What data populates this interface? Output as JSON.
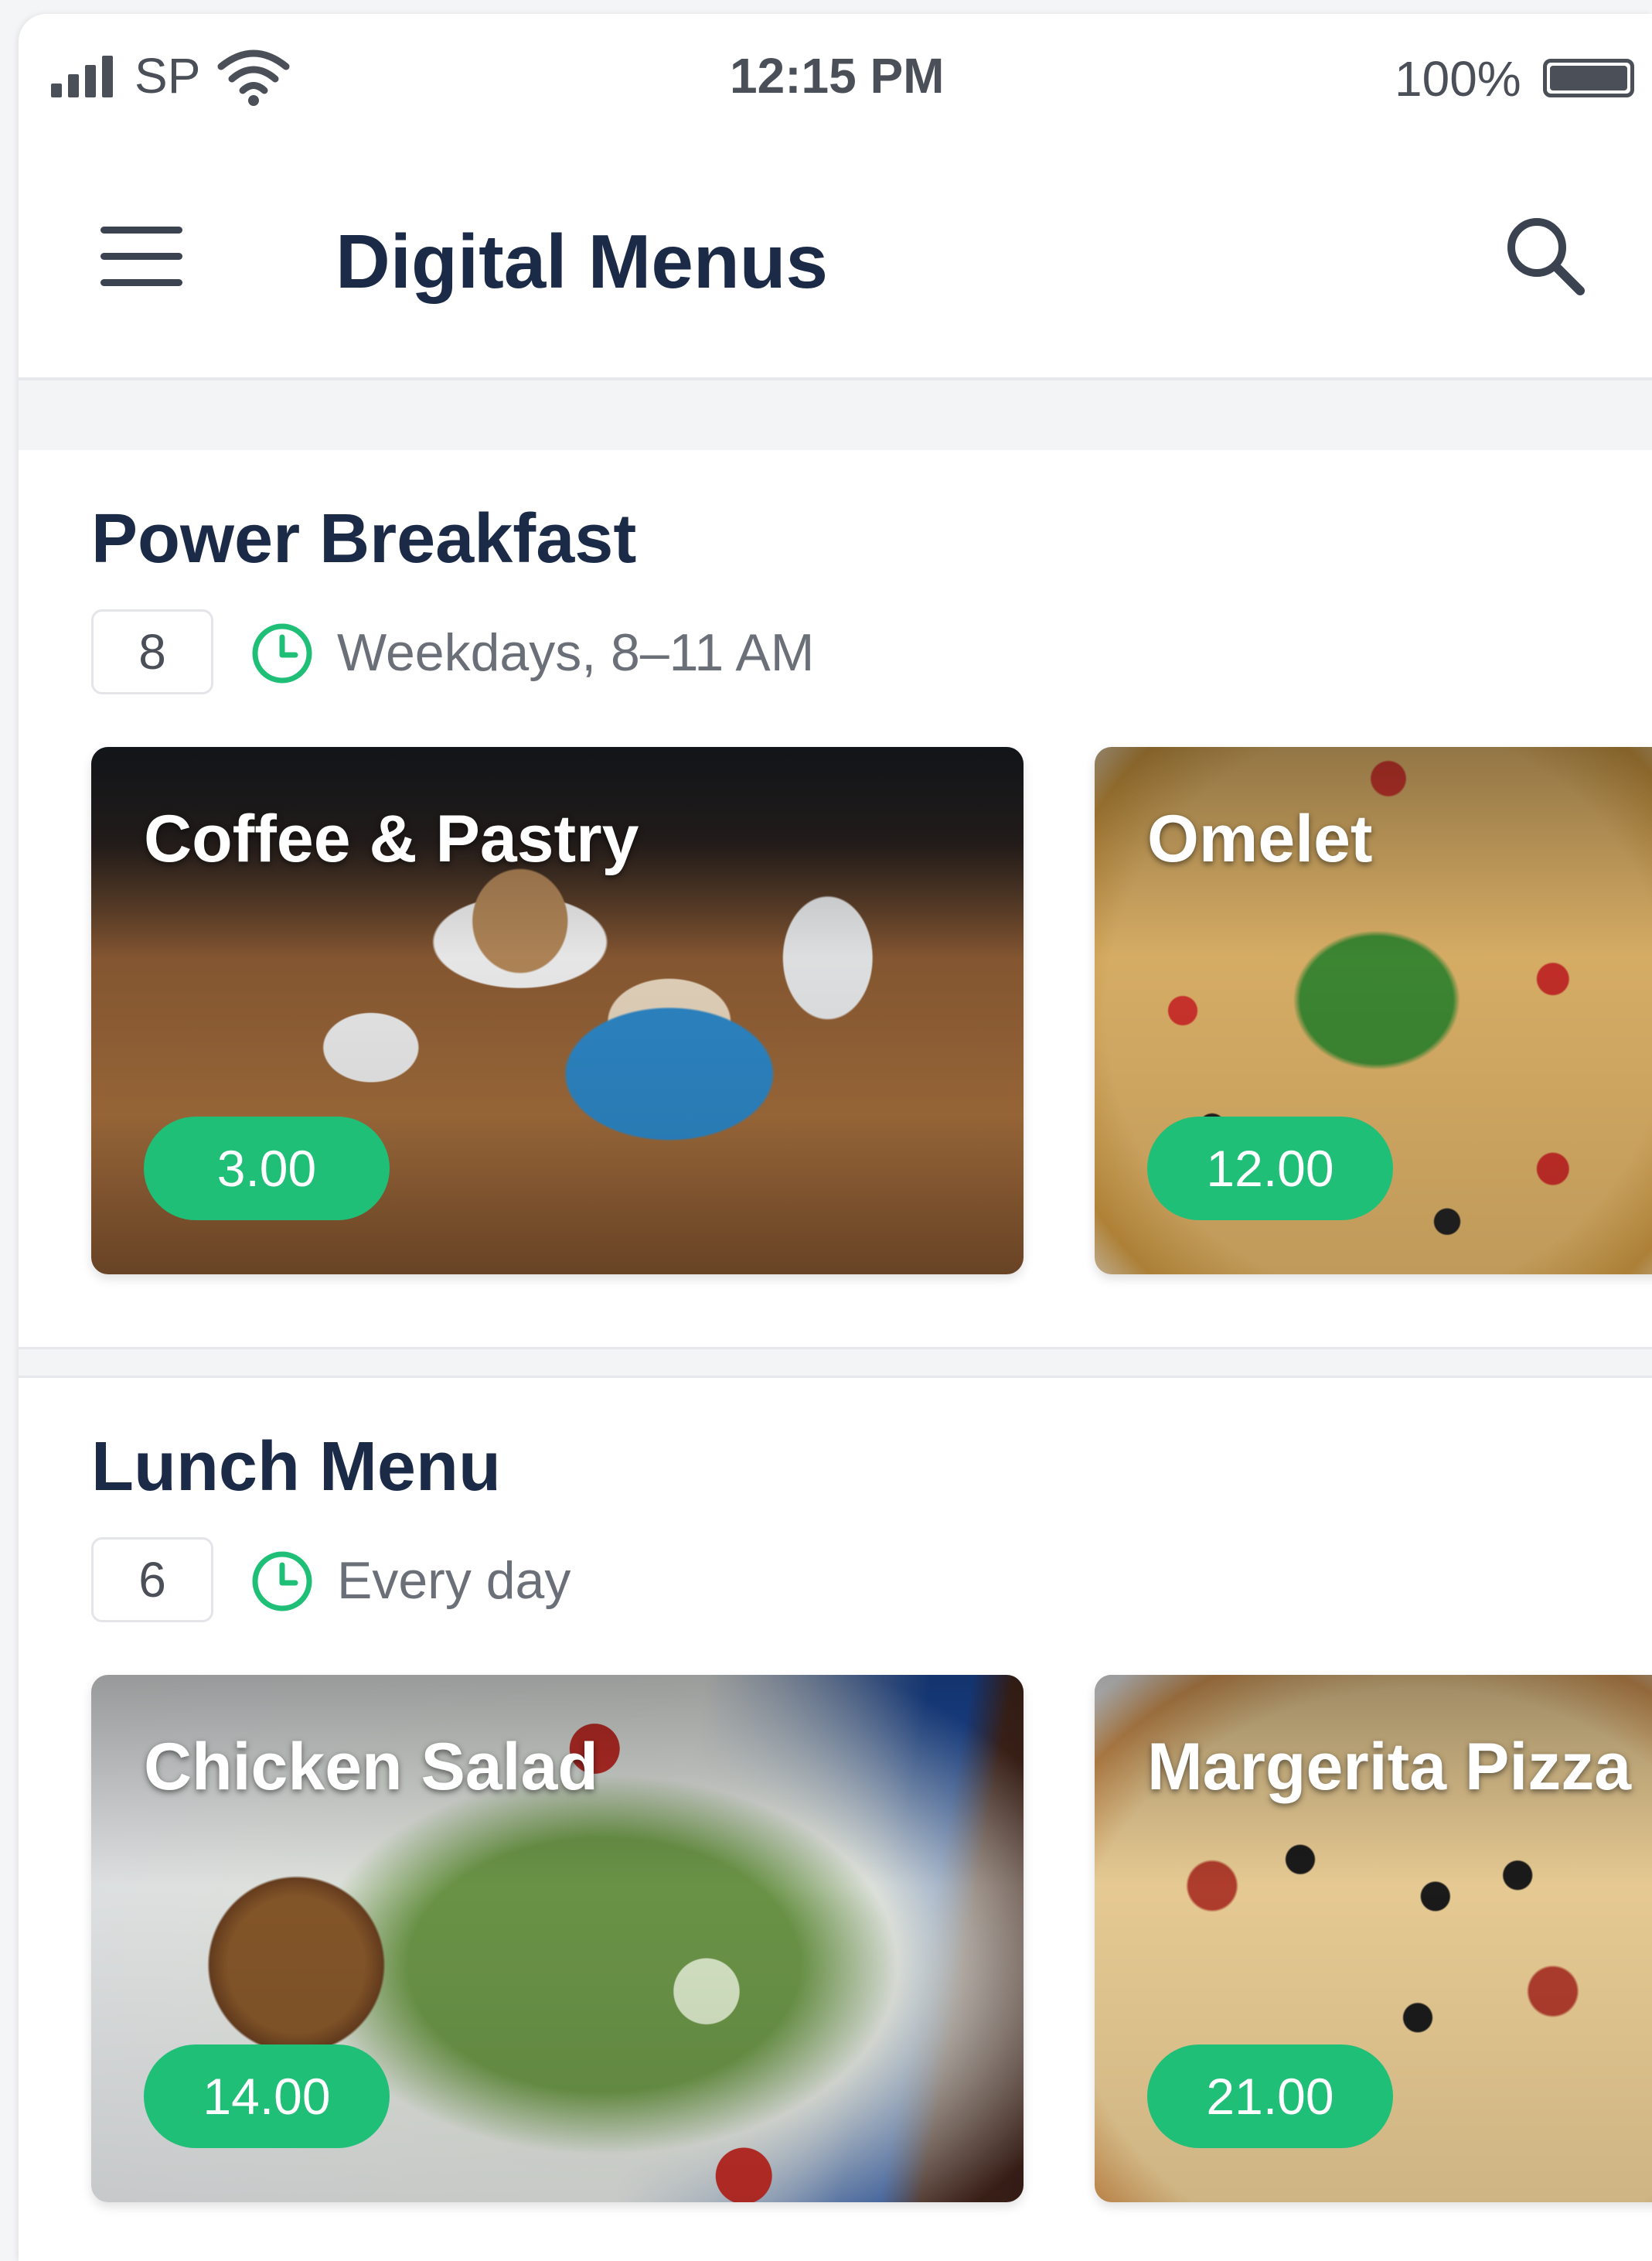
{
  "status_bar": {
    "carrier": "SP",
    "time": "12:15 PM",
    "battery": "100%"
  },
  "app_bar": {
    "title": "Digital Menus",
    "menu_icon": "hamburger-menu-icon",
    "search_icon": "search-icon"
  },
  "colors": {
    "accent": "#1fbf78",
    "title": "#1b2a47",
    "muted": "#6a6f78"
  },
  "sections": [
    {
      "title": "Power Breakfast",
      "count": "8",
      "schedule": "Weekdays, 8–11 AM",
      "items": [
        {
          "name": "Coffee & Pastry",
          "price": "3.00"
        },
        {
          "name": "Omelet",
          "price": "12.00"
        }
      ]
    },
    {
      "title": "Lunch Menu",
      "count": "6",
      "schedule": "Every day",
      "items": [
        {
          "name": "Chicken Salad",
          "price": "14.00"
        },
        {
          "name": "Margerita Pizza",
          "price": "21.00"
        }
      ]
    }
  ]
}
